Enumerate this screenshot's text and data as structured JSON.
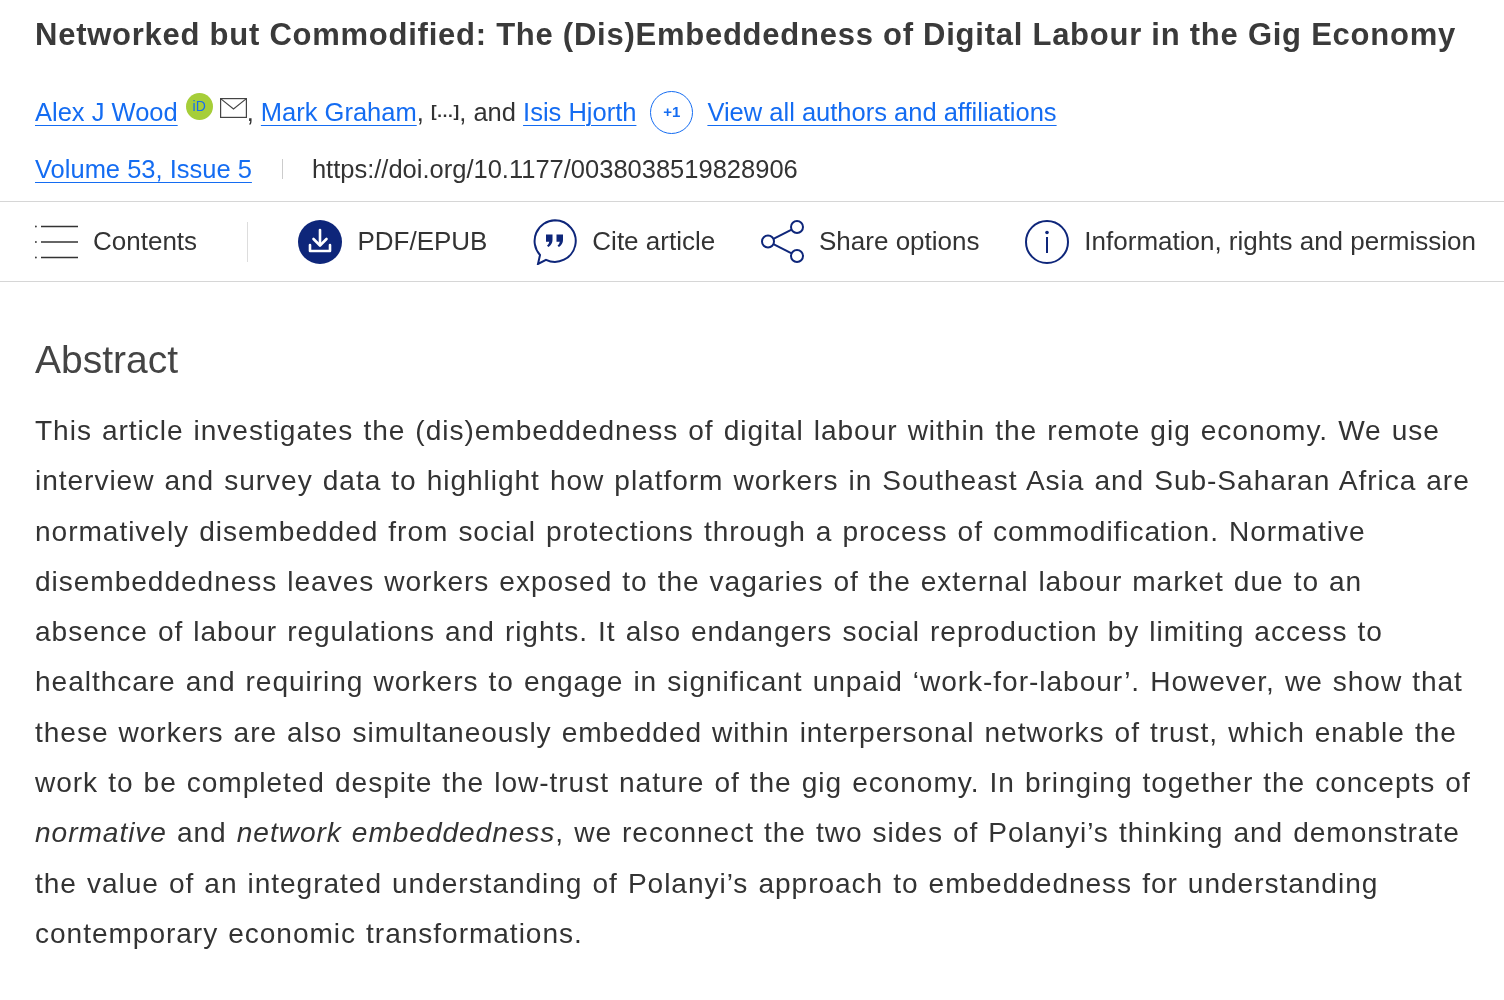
{
  "article": {
    "title": "Networked but Commodified: The (Dis)Embeddedness of Digital Labour in the Gig Economy",
    "byline": [
      {
        "kind": "author",
        "text": "Alex J Wood",
        "orcid_badge": "iD",
        "email": true
      },
      {
        "kind": "text",
        "text": ", "
      },
      {
        "kind": "author",
        "text": "Mark Graham"
      },
      {
        "kind": "text",
        "text": ", "
      },
      {
        "kind": "elided",
        "text": "[…]"
      },
      {
        "kind": "text",
        "text": ", and "
      },
      {
        "kind": "author",
        "text": "Isis Hjorth"
      },
      {
        "kind": "more",
        "text": "+1"
      },
      {
        "kind": "link",
        "text": "View all authors and affiliations"
      }
    ],
    "issue_link": "Volume 53, Issue 5",
    "doi": "https://doi.org/10.1177/0038038519828906"
  },
  "toolbar": [
    {
      "kind": "contents",
      "label": "Contents"
    },
    {
      "kind": "pdf",
      "label": "PDF/EPUB"
    },
    {
      "kind": "cite",
      "label": "Cite article"
    },
    {
      "kind": "share",
      "label": "Share options"
    },
    {
      "kind": "info",
      "label": "Information, rights and permission"
    }
  ],
  "abstract": {
    "heading": "Abstract",
    "text": "This article investigates the (dis)embeddedness of digital labour within the remote gig economy. We use interview and survey data to highlight how platform workers in Southeast Asia and Sub-Saharan Africa are normatively disembedded from social protections through a process of commodification. Normative disembeddedness leaves workers exposed to the vagaries of the external labour market due to an absence of labour regulations and rights. It also endangers social reproduction by limiting access to healthcare and requiring workers to engage in significant unpaid ‘work-for-labour’. However, we show that these workers are also simultaneously embedded within interpersonal networks of trust, which enable the work to be completed despite the low-trust nature of the gig economy. In bringing together the concepts of *normative* and *network embeddedness*, we reconnect the two sides of Polanyi’s thinking and demonstrate the value of an integrated understanding of Polanyi’s approach to embeddedness for understanding contemporary economic transformations."
  }
}
